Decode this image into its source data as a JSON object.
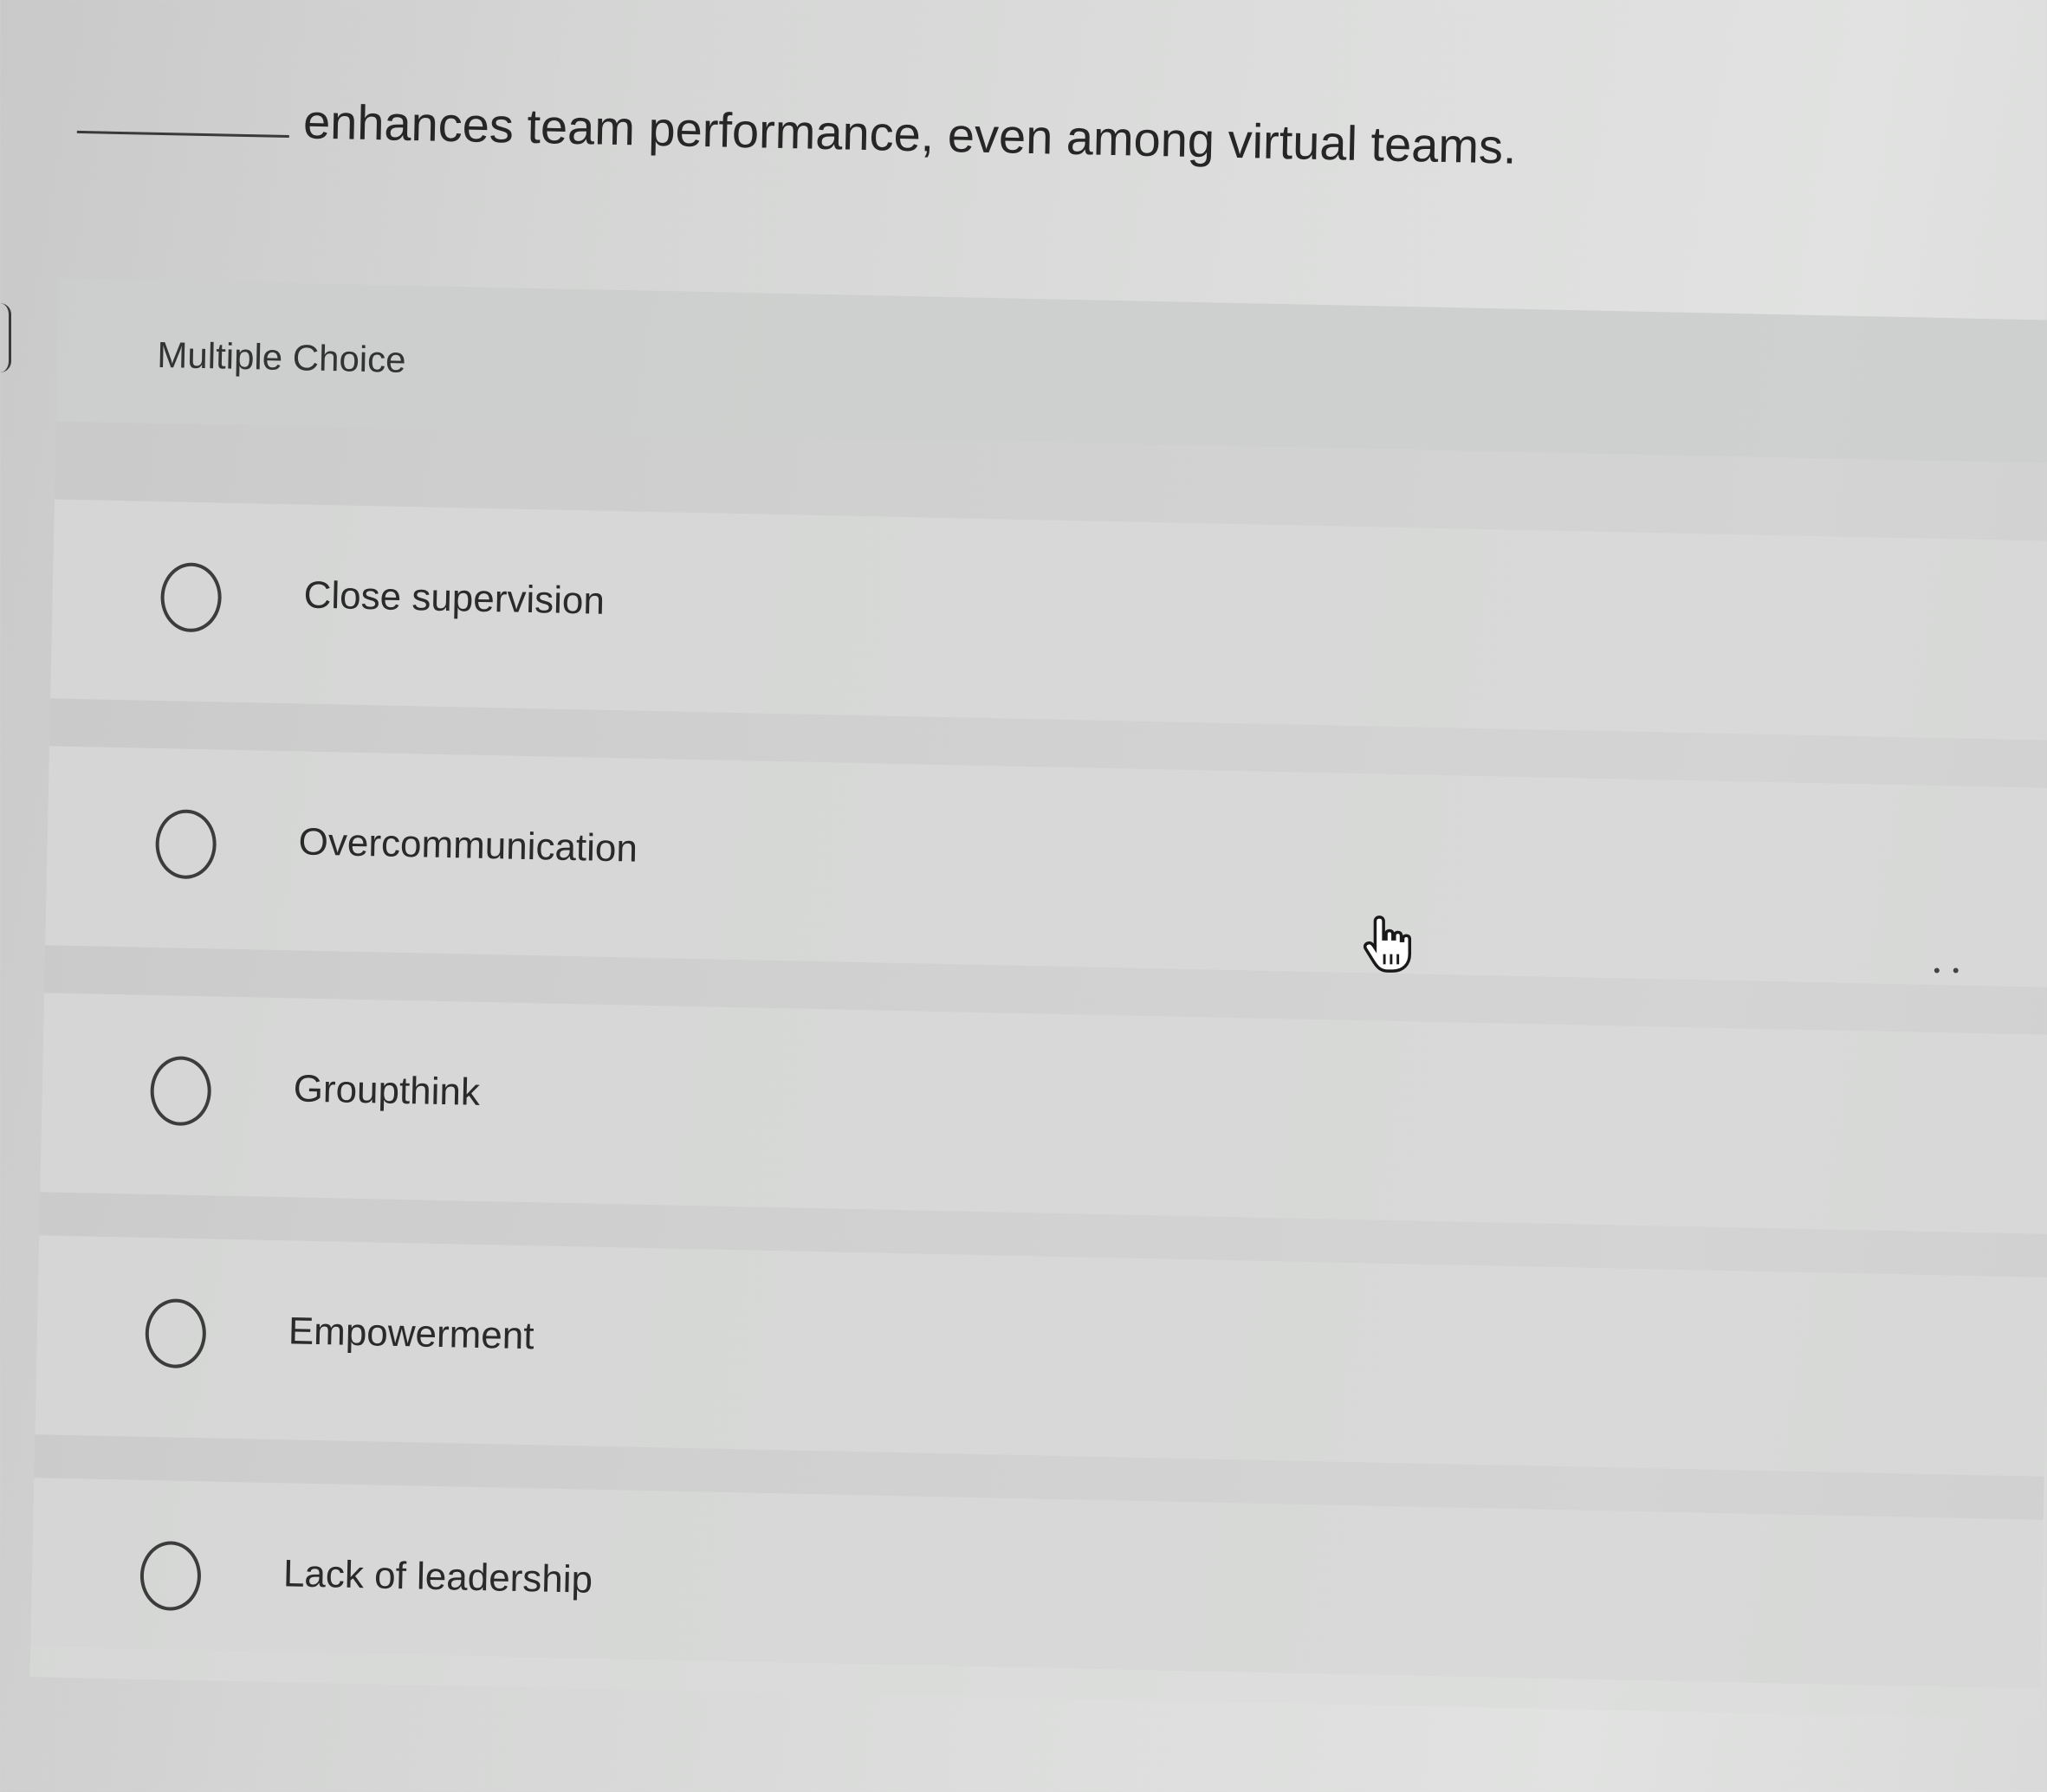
{
  "question": {
    "text": "enhances team performance, even among virtual teams."
  },
  "multiple_choice": {
    "label": "Multiple Choice",
    "options": [
      {
        "label": "Close supervision",
        "selected": false
      },
      {
        "label": "Overcommunication",
        "selected": false
      },
      {
        "label": "Groupthink",
        "selected": false
      },
      {
        "label": "Empowerment",
        "selected": false
      },
      {
        "label": "Lack of leadership",
        "selected": false
      }
    ]
  },
  "cursor": {
    "icon": "hand-pointer-icon"
  },
  "overflow": {
    "icon": "more-dots-icon",
    "text": "• •"
  }
}
